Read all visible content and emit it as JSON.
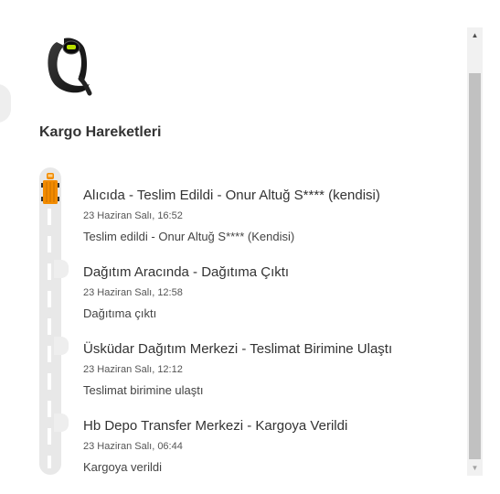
{
  "section": {
    "title": "Kargo Hareketleri"
  },
  "product": {
    "icon": "fitness-band-icon"
  },
  "events": [
    {
      "title": "Alıcıda - Teslim Edildi - Onur Altuğ S**** (kendisi)",
      "date": "23 Haziran Salı, 16:52",
      "desc": "Teslim edildi - Onur Altuğ S**** (Kendisi)"
    },
    {
      "title": "Dağıtım Aracında - Dağıtıma Çıktı",
      "date": "23 Haziran Salı, 12:58",
      "desc": "Dağıtıma çıktı"
    },
    {
      "title": "Üsküdar Dağıtım Merkezi - Teslimat Birimine Ulaştı",
      "date": "23 Haziran Salı, 12:12",
      "desc": "Teslimat birimine ulaştı"
    },
    {
      "title": "Hb Depo Transfer Merkezi - Kargoya Verildi",
      "date": "23 Haziran Salı, 06:44",
      "desc": "Kargoya verildi"
    }
  ],
  "colors": {
    "truck": "#f28b00",
    "road": "#e8e8e8",
    "text": "#333333"
  },
  "icons": {
    "truck": "truck-icon",
    "scroll_up": "scroll-up-arrow-icon",
    "scroll_down": "scroll-down-arrow-icon"
  }
}
